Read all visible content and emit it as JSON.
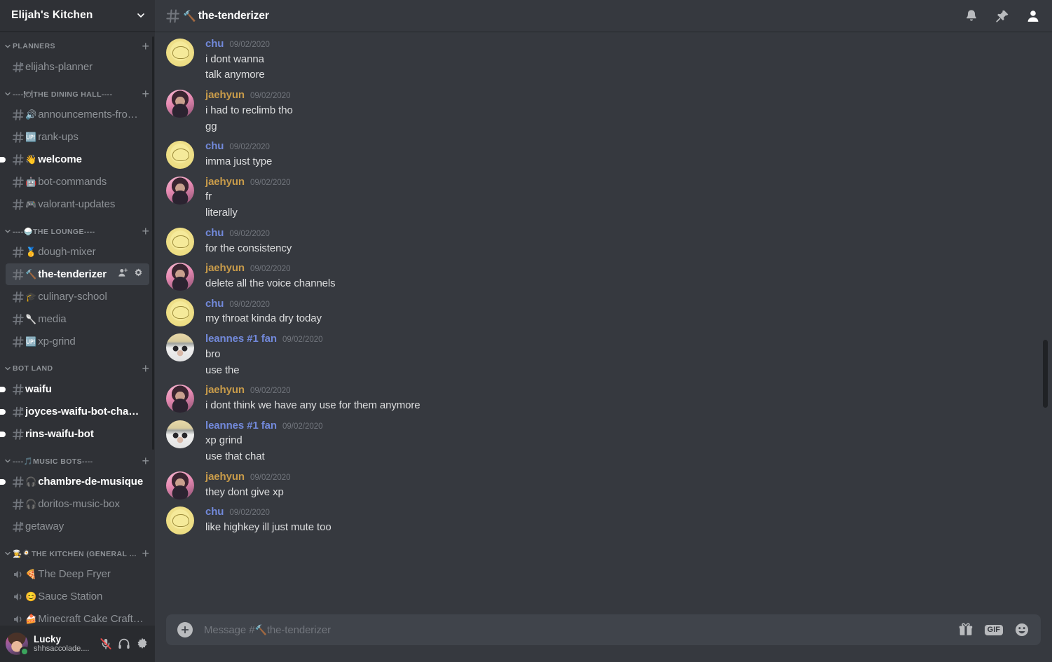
{
  "server": {
    "name": "Elijah's Kitchen",
    "dropdown_icon": "chevron-down-icon"
  },
  "sidebar": {
    "categories": [
      {
        "name": "PLANNERS",
        "add_label": "+",
        "channels": [
          {
            "name": "elijahs-planner",
            "emoji": "",
            "hash": "thread",
            "unread": false,
            "active": false
          }
        ]
      },
      {
        "name": "----🍽THE DINING HALL----",
        "add_label": "+",
        "channels": [
          {
            "name": "announcements-from...",
            "emoji": "🔊",
            "hash": "hash",
            "unread": false,
            "active": false
          },
          {
            "name": "rank-ups",
            "emoji": "🆙",
            "hash": "hash",
            "unread": false,
            "active": false
          },
          {
            "name": "welcome",
            "emoji": "👋",
            "hash": "hash",
            "unread": true,
            "active": false
          },
          {
            "name": "bot-commands",
            "emoji": "🤖",
            "hash": "hash",
            "unread": false,
            "active": false
          },
          {
            "name": "valorant-updates",
            "emoji": "🎮",
            "hash": "hash",
            "unread": false,
            "active": false
          }
        ]
      },
      {
        "name": "----🍚THE LOUNGE----",
        "add_label": "+",
        "channels": [
          {
            "name": "dough-mixer",
            "emoji": "🥇",
            "hash": "hash",
            "unread": false,
            "active": false
          },
          {
            "name": "the-tenderizer",
            "emoji": "🔨",
            "hash": "hash",
            "unread": false,
            "active": true
          },
          {
            "name": "culinary-school",
            "emoji": "🎓",
            "hash": "hash",
            "unread": false,
            "active": false
          },
          {
            "name": "media",
            "emoji": "🥄",
            "hash": "hash",
            "unread": false,
            "active": false
          },
          {
            "name": "xp-grind",
            "emoji": "🆙",
            "hash": "hash",
            "unread": false,
            "active": false
          }
        ]
      },
      {
        "name": "BOT LAND",
        "add_label": "+",
        "channels": [
          {
            "name": "waifu",
            "emoji": "",
            "hash": "hash",
            "unread": true,
            "active": false
          },
          {
            "name": "joyces-waifu-bot-channel",
            "emoji": "",
            "hash": "thread",
            "unread": true,
            "active": false
          },
          {
            "name": "rins-waifu-bot",
            "emoji": "",
            "hash": "hash",
            "unread": true,
            "active": false
          }
        ]
      },
      {
        "name": "----🎵MUSIC BOTS----",
        "add_label": "+",
        "channels": [
          {
            "name": "chambre-de-musique",
            "emoji": "🎧",
            "hash": "hash",
            "unread": true,
            "active": false
          },
          {
            "name": "doritos-music-box",
            "emoji": "🎧",
            "hash": "hash",
            "unread": false,
            "active": false
          },
          {
            "name": "getaway",
            "emoji": "",
            "hash": "thread",
            "unread": false,
            "active": false
          }
        ]
      },
      {
        "name": "👩‍🍳🍳THE KITCHEN (GENERAL VC)",
        "add_label": "+",
        "channels": [
          {
            "name": "The Deep Fryer",
            "emoji": "🍕",
            "hash": "voice",
            "unread": false,
            "active": false
          },
          {
            "name": "Sauce Station",
            "emoji": "😊",
            "hash": "voice",
            "unread": false,
            "active": false
          },
          {
            "name": "Minecraft Cake Crafti...",
            "emoji": "🍰",
            "hash": "voice",
            "unread": false,
            "active": false
          }
        ]
      }
    ]
  },
  "user_panel": {
    "name": "Lucky",
    "tag": "shhsaccolade....",
    "status": "online",
    "icons": [
      "microphone-muted-icon",
      "headphones-icon",
      "settings-gear-icon"
    ]
  },
  "header": {
    "channel_emoji": "🔨",
    "channel_name": "the-tenderizer",
    "icons": [
      "notification-bell-icon",
      "pinned-messages-icon",
      "member-list-icon"
    ]
  },
  "colors": {
    "author_chu": "#7289da",
    "author_jaehyun": "#c89b4a",
    "author_leannes": "#7289da",
    "message_text": "#dcddde",
    "timestamp": "#72767d",
    "sidebar_bg": "#2f3136",
    "chat_bg": "#36393f",
    "userpanel_bg": "#292b2f",
    "active_channel_bg": "#40444b"
  },
  "messages": [
    {
      "author": "chu",
      "author_color_key": "author_chu",
      "avatar": "av-chu",
      "timestamp": "09/02/2020",
      "lines": [
        "i dont wanna",
        "talk anymore"
      ]
    },
    {
      "author": "jaehyun",
      "author_color_key": "author_jaehyun",
      "avatar": "av-jae",
      "timestamp": "09/02/2020",
      "lines": [
        "i had to reclimb tho",
        "gg"
      ]
    },
    {
      "author": "chu",
      "author_color_key": "author_chu",
      "avatar": "av-chu",
      "timestamp": "09/02/2020",
      "lines": [
        "imma just type"
      ]
    },
    {
      "author": "jaehyun",
      "author_color_key": "author_jaehyun",
      "avatar": "av-jae",
      "timestamp": "09/02/2020",
      "lines": [
        "fr",
        "literally"
      ]
    },
    {
      "author": "chu",
      "author_color_key": "author_chu",
      "avatar": "av-chu",
      "timestamp": "09/02/2020",
      "lines": [
        "for the consistency"
      ]
    },
    {
      "author": "jaehyun",
      "author_color_key": "author_jaehyun",
      "avatar": "av-jae",
      "timestamp": "09/02/2020",
      "lines": [
        "delete all the voice channels"
      ]
    },
    {
      "author": "chu",
      "author_color_key": "author_chu",
      "avatar": "av-chu",
      "timestamp": "09/02/2020",
      "lines": [
        "my throat kinda dry today"
      ]
    },
    {
      "author": "leannes #1 fan",
      "author_color_key": "author_leannes",
      "avatar": "av-lea",
      "timestamp": "09/02/2020",
      "lines": [
        "bro",
        "use the"
      ]
    },
    {
      "author": "jaehyun",
      "author_color_key": "author_jaehyun",
      "avatar": "av-jae",
      "timestamp": "09/02/2020",
      "lines": [
        "i dont think we have any use for them anymore"
      ]
    },
    {
      "author": "leannes #1 fan",
      "author_color_key": "author_leannes",
      "avatar": "av-lea",
      "timestamp": "09/02/2020",
      "lines": [
        "xp grind",
        "use that chat"
      ]
    },
    {
      "author": "jaehyun",
      "author_color_key": "author_jaehyun",
      "avatar": "av-jae",
      "timestamp": "09/02/2020",
      "lines": [
        "they dont give xp"
      ]
    },
    {
      "author": "chu",
      "author_color_key": "author_chu",
      "avatar": "av-chu",
      "timestamp": "09/02/2020",
      "lines": [
        "like highkey ill just mute too"
      ]
    }
  ],
  "composer": {
    "placeholder_prefix": "Message #",
    "placeholder_emoji": "🔨",
    "placeholder_channel": "the-tenderizer",
    "value": "",
    "gif_label": "GIF",
    "icons": [
      "add-attachment-icon",
      "gift-icon",
      "gif-icon",
      "emoji-picker-icon"
    ]
  }
}
